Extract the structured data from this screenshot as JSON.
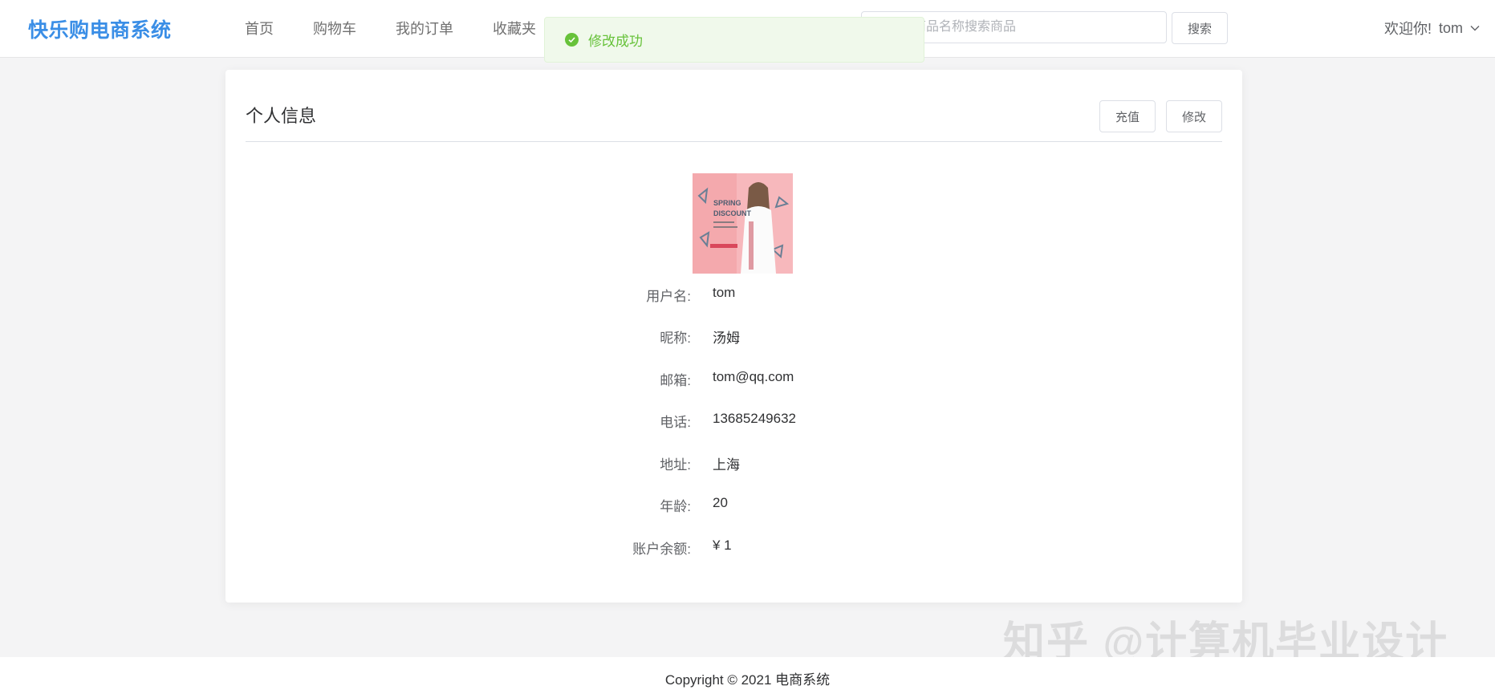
{
  "header": {
    "logo": "快乐购电商系统",
    "nav": [
      "首页",
      "购物车",
      "我的订单",
      "收藏夹"
    ],
    "search": {
      "placeholder": "请输入商品名称搜索商品",
      "button": "搜索"
    },
    "user": {
      "welcome": "欢迎你!",
      "name": "tom"
    }
  },
  "toast": {
    "message": "修改成功",
    "type": "success"
  },
  "profile": {
    "title": "个人信息",
    "buttons": {
      "recharge": "充值",
      "edit": "修改"
    },
    "avatar_text": {
      "line1": "SPRING",
      "line2": "DISCOUNT"
    },
    "fields": [
      {
        "label": "用户名:",
        "value": "tom"
      },
      {
        "label": "昵称:",
        "value": "汤姆"
      },
      {
        "label": "邮箱:",
        "value": "tom@qq.com"
      },
      {
        "label": "电话:",
        "value": "13685249632"
      },
      {
        "label": "地址:",
        "value": "上海"
      },
      {
        "label": "年龄:",
        "value": "20"
      },
      {
        "label": "账户余额:",
        "value": "¥ 1"
      }
    ]
  },
  "watermark": "知乎 @计算机毕业设计",
  "footer": {
    "copyright": "Copyright © 2021 电商系统"
  },
  "colors": {
    "brand": "#3a8ee6",
    "success": "#67c23a",
    "success_bg": "#f0f9eb"
  }
}
